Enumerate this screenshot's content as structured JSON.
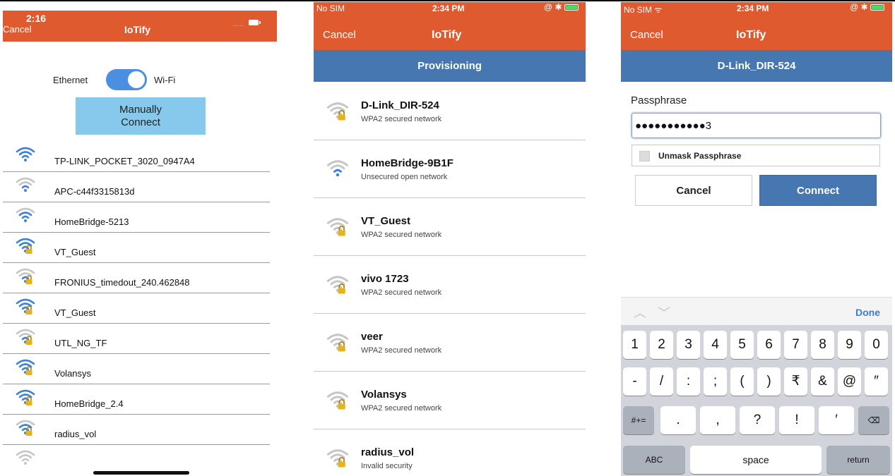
{
  "screen1": {
    "status_time": "2:16",
    "status_signal": ".....",
    "header_cancel": "Cancel",
    "header_title": "IoTify",
    "ethernet_label": "Ethernet",
    "wifi_label": "Wi-Fi",
    "manual_connect_label": "Manually\nConnect",
    "networks": [
      {
        "name": "TP-LINK_POCKET_3020_0947A4",
        "locked": false,
        "strength": 3
      },
      {
        "name": "APC-c44f3315813d",
        "locked": false,
        "strength": 1
      },
      {
        "name": "HomeBridge-5213",
        "locked": false,
        "strength": 2
      },
      {
        "name": "VT_Guest",
        "locked": true,
        "strength": 3
      },
      {
        "name": "FRONIUS_timedout_240.462848",
        "locked": true,
        "strength": 1
      },
      {
        "name": "VT_Guest",
        "locked": true,
        "strength": 3
      },
      {
        "name": "UTL_NG_TF",
        "locked": true,
        "strength": 1
      },
      {
        "name": "Volansys",
        "locked": true,
        "strength": 3
      },
      {
        "name": "HomeBridge_2.4",
        "locked": true,
        "strength": 3
      },
      {
        "name": "radius_vol",
        "locked": true,
        "strength": 2
      },
      {
        "name": "",
        "locked": false,
        "strength": 0
      }
    ]
  },
  "screen2": {
    "carrier": "No SIM",
    "time": "2:34 PM",
    "status_icons": "@ ✱",
    "header_cancel": "Cancel",
    "header_title": "IoTify",
    "subheader": "Provisioning",
    "networks": [
      {
        "name": "D-Link_DIR-524",
        "security": "WPA2 secured network",
        "locked": true
      },
      {
        "name": "HomeBridge-9B1F",
        "security": "Unsecured open network",
        "locked": false
      },
      {
        "name": "VT_Guest",
        "security": "WPA2 secured network",
        "locked": true
      },
      {
        "name": "vivo 1723",
        "security": "WPA2 secured network",
        "locked": true
      },
      {
        "name": "veer",
        "security": "WPA2 secured network",
        "locked": true
      },
      {
        "name": "Volansys",
        "security": "WPA2 secured network",
        "locked": true
      },
      {
        "name": "radius_vol",
        "security": "Invalid security",
        "locked": true
      }
    ]
  },
  "screen3": {
    "carrier": "No SIM ᯤ",
    "time": "2:34 PM",
    "status_icons": "@ ✱",
    "header_cancel": "Cancel",
    "header_title": "IoTify",
    "subheader": "D-Link_DIR-524",
    "passphrase_label": "Passphrase",
    "passphrase_value": "●●●●●●●●●●●3",
    "unmask_label": "Unmask Passphrase",
    "cancel_label": "Cancel",
    "connect_label": "Connect",
    "keyboard": {
      "done_label": "Done",
      "row1": [
        "1",
        "2",
        "3",
        "4",
        "5",
        "6",
        "7",
        "8",
        "9",
        "0"
      ],
      "row2": [
        "-",
        "/",
        ":",
        ";",
        "(",
        ")",
        "₹",
        "&",
        "@",
        "″"
      ],
      "row3": [
        "#+=",
        ".",
        ",",
        "?",
        "!",
        "′",
        "⌫"
      ],
      "row4": [
        "ABC",
        "space",
        "return"
      ]
    }
  },
  "colors": {
    "header_orange": "#e05a30",
    "subbar_blue": "#4677b0",
    "wifi_blue": "#3d82d8",
    "wifi_gray": "#c6c6c6",
    "lock_yellow": "#e8b21a"
  }
}
